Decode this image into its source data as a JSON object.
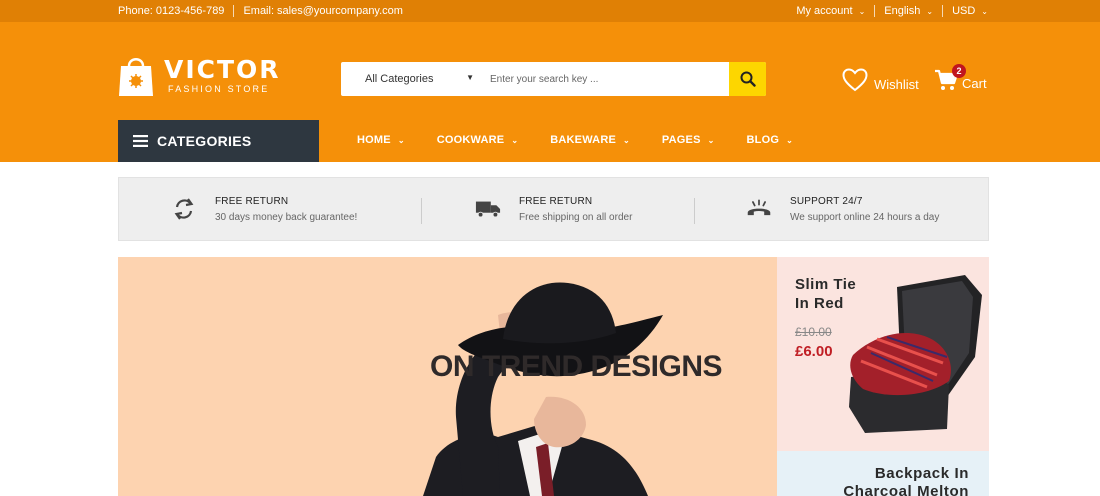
{
  "topbar": {
    "phone": "Phone: 0123-456-789",
    "email": "Email: sales@yourcompany.com",
    "account": "My account",
    "language": "English",
    "currency": "USD"
  },
  "header": {
    "brand": "VICTOR",
    "tagline": "FASHION STORE",
    "wishlist_label": "Wishlist",
    "cart_label": "Cart",
    "cart_count": "2"
  },
  "search": {
    "category": "All Categories",
    "placeholder": "Enter your search key ..."
  },
  "nav": {
    "categories_label": "CATEGORIES",
    "items": [
      {
        "label": "HOME"
      },
      {
        "label": "COOKWARE"
      },
      {
        "label": "BAKEWARE"
      },
      {
        "label": "PAGES"
      },
      {
        "label": "BLOG"
      }
    ]
  },
  "features": [
    {
      "icon": "refresh-icon",
      "title": "FREE RETURN",
      "desc": "30 days money back guarantee!"
    },
    {
      "icon": "truck-icon",
      "title": "FREE RETURN",
      "desc": "Free shipping on all order"
    },
    {
      "icon": "phone-icon",
      "title": "SUPPORT 24/7",
      "desc": "We support online 24 hours a day"
    }
  ],
  "hero": {
    "headline": "ON TREND DESIGNS"
  },
  "promos": [
    {
      "name": "Slim Tie\nIn Red",
      "old_price": "£10.00",
      "new_price": "£6.00"
    },
    {
      "name": "Backpack In\nCharcoal Melton"
    }
  ],
  "colors": {
    "topbar": "#e08005",
    "header": "#f59009",
    "categories_bg": "#2e3740",
    "search_button": "#fdd600",
    "badge": "#c0151f",
    "sale_price": "#c01e24"
  }
}
